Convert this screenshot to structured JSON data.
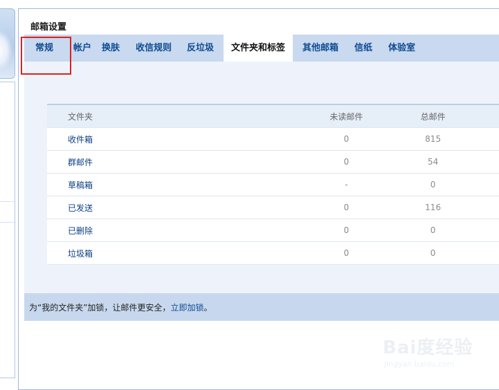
{
  "panel": {
    "title": "邮箱设置"
  },
  "tabs": [
    {
      "label": "常规",
      "active": false
    },
    {
      "label": "帐户",
      "active": false
    },
    {
      "label": "换肤",
      "active": false
    },
    {
      "label": "收信规则",
      "active": false
    },
    {
      "label": "反垃圾",
      "active": false
    },
    {
      "label": "文件夹和标签",
      "active": true
    },
    {
      "label": "其他邮箱",
      "active": false
    },
    {
      "label": "信纸",
      "active": false
    },
    {
      "label": "体验室",
      "active": false
    }
  ],
  "folder_table": {
    "headers": {
      "name": "文件夹",
      "unread": "未读邮件",
      "total": "总邮件"
    },
    "rows": [
      {
        "name": "收件箱",
        "unread": "0",
        "total": "815"
      },
      {
        "name": "群邮件",
        "unread": "0",
        "total": "54"
      },
      {
        "name": "草稿箱",
        "unread": "-",
        "total": "0"
      },
      {
        "name": "已发送",
        "unread": "0",
        "total": "116"
      },
      {
        "name": "已删除",
        "unread": "0",
        "total": "0"
      },
      {
        "name": "垃圾箱",
        "unread": "0",
        "total": "0"
      }
    ]
  },
  "footer": {
    "text_before": "为“我的文件夹”加锁，让邮件更安全，",
    "link": "立即加锁",
    "text_after": "。"
  },
  "watermark": {
    "brand": "Bai度经验",
    "sub": "jingyan.baidu.com"
  },
  "colors": {
    "tab_bar": "#c9d9ef",
    "link": "#0f4b92",
    "highlight": "#e0201c"
  }
}
